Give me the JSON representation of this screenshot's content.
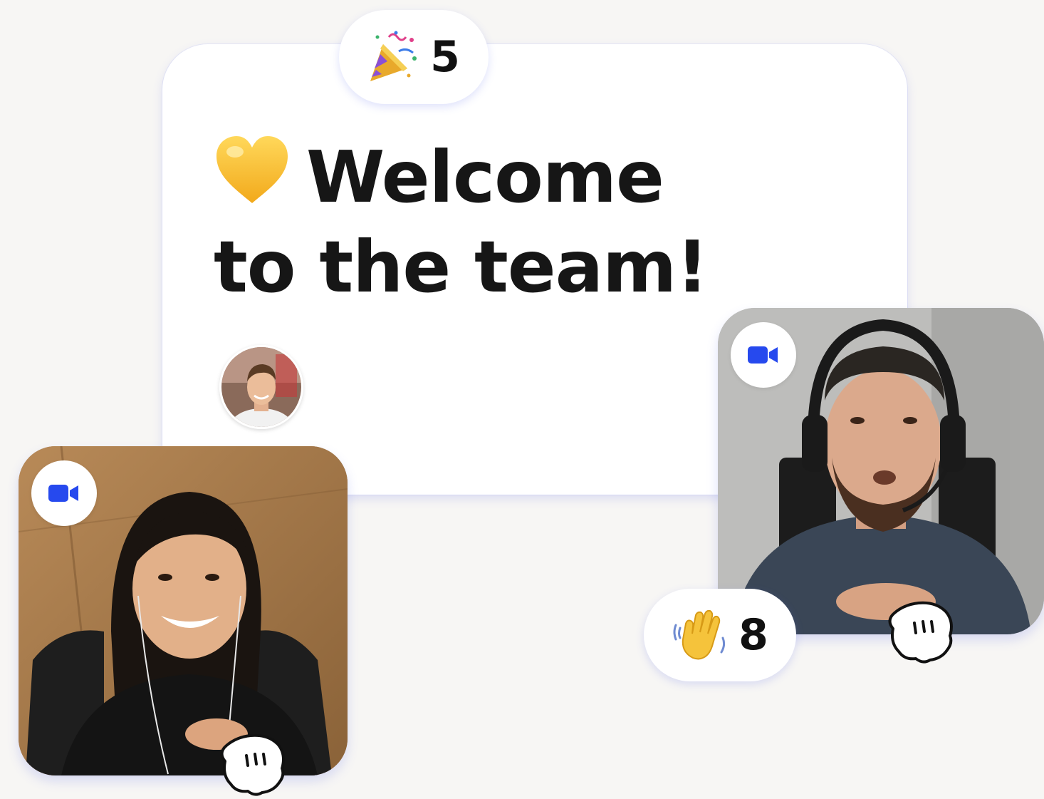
{
  "card": {
    "headline": "Welcome to the team!",
    "headline_emoji": "yellow-heart"
  },
  "reactions": {
    "party": {
      "emoji": "party-popper",
      "count": "5"
    },
    "wave": {
      "emoji": "waving-hand",
      "count": "8"
    }
  },
  "participants": [
    {
      "video_icon": "video-camera-icon",
      "cursor": "hand-cursor-icon"
    },
    {
      "video_icon": "video-camera-icon",
      "cursor": "hand-cursor-icon"
    }
  ],
  "colors": {
    "background": "#f7f6f4",
    "card": "#ffffff",
    "accent_blue": "#2649ee",
    "heart": "#f7c531",
    "text": "#161616"
  }
}
